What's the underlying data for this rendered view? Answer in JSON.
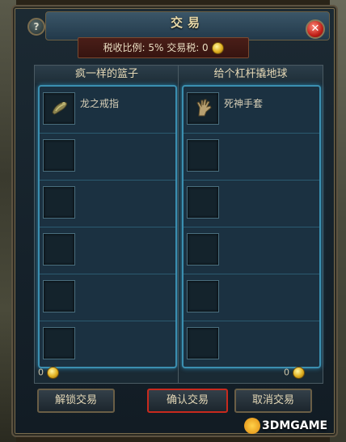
{
  "window": {
    "title": "交易"
  },
  "tax": {
    "label": "税收比例: 5%   交易税: 0"
  },
  "left_panel": {
    "name": "疯一样的篮子",
    "items": [
      "龙之戒指",
      "",
      "",
      "",
      "",
      ""
    ],
    "gold": "0"
  },
  "right_panel": {
    "name": "给个杠杆撬地球",
    "items": [
      "死神手套",
      "",
      "",
      "",
      "",
      ""
    ],
    "gold": "0"
  },
  "buttons": {
    "unlock": "解锁交易",
    "confirm": "确认交易",
    "cancel": "取消交易"
  },
  "watermark": {
    "text": "3DMGAME"
  },
  "icons": {
    "help": "?",
    "close": "✕"
  }
}
